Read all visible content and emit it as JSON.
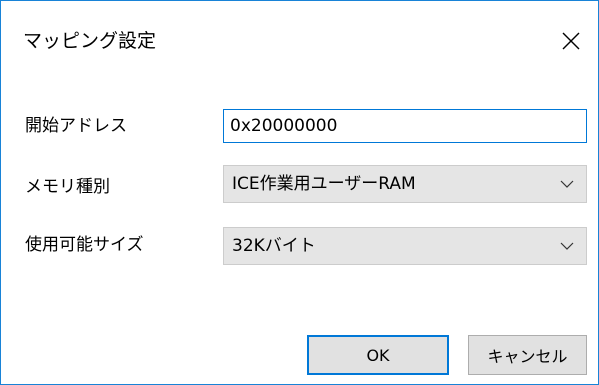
{
  "dialog": {
    "title": "マッピング設定",
    "close_icon": "close-icon"
  },
  "form": {
    "start_address": {
      "label": "開始アドレス",
      "value": "0x20000000"
    },
    "memory_type": {
      "label": "メモリ種別",
      "selected": "ICE作業用ユーザーRAM",
      "arrow_icon": "chevron-down-icon"
    },
    "usable_size": {
      "label": "使用可能サイズ",
      "selected": "32Kバイト",
      "arrow_icon": "chevron-down-icon"
    }
  },
  "buttons": {
    "ok_label": "OK",
    "cancel_label": "キャンセル"
  },
  "colors": {
    "accent": "#0078d7",
    "window_border": "#1883d7",
    "button_face": "#e1e1e1",
    "combo_face": "#e5e5e5"
  }
}
